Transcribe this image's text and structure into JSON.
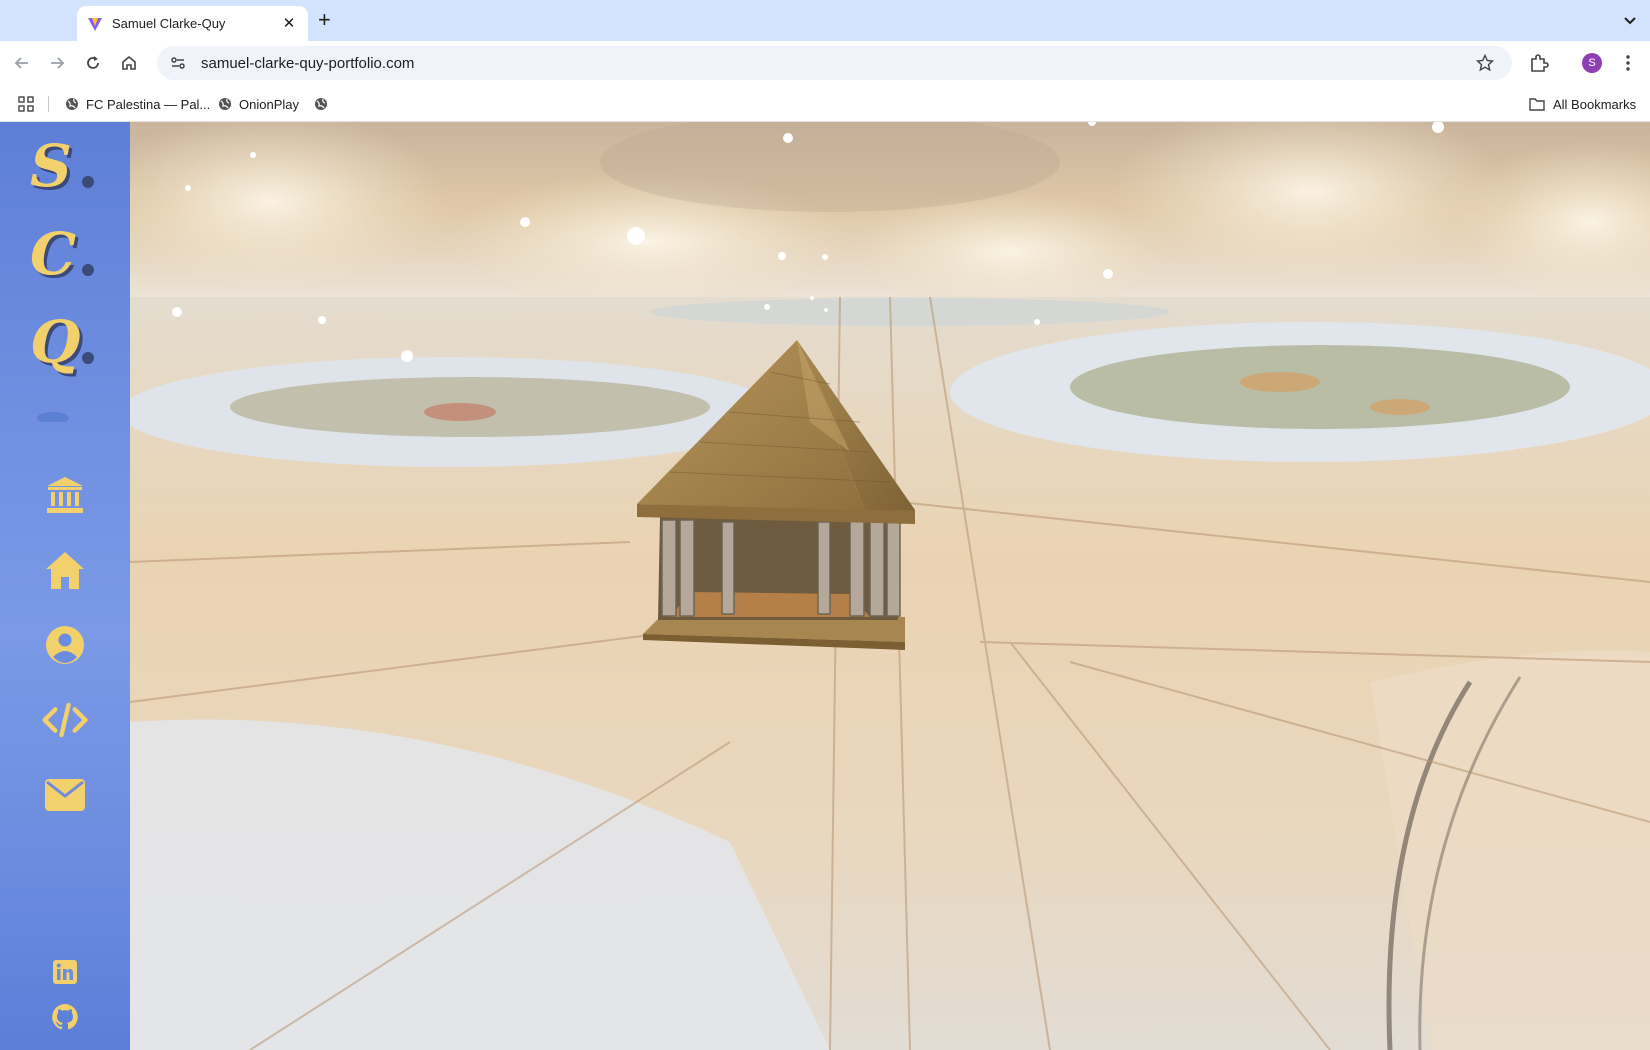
{
  "browser": {
    "tab_title": "Samuel Clarke-Quy",
    "tab_close": "✕",
    "new_tab": "+",
    "url": "samuel-clarke-quy-portfolio.com",
    "profile_initial": "S",
    "profile_color": "#8e3fb3"
  },
  "bookmarks": {
    "items": [
      {
        "label": "FC Palestina — Pal...",
        "icon": "globe-icon"
      },
      {
        "label": "OnionPlay",
        "icon": "globe-icon"
      },
      {
        "label": "",
        "icon": "globe-icon"
      }
    ],
    "all_label": "All Bookmarks"
  },
  "sidebar": {
    "logos": [
      {
        "letter": "S",
        "name": "logo-s"
      },
      {
        "letter": "C",
        "name": "logo-c"
      },
      {
        "letter": "Q",
        "name": "logo-q"
      }
    ],
    "nav": [
      {
        "name": "museum-icon"
      },
      {
        "name": "home-icon"
      },
      {
        "name": "profile-icon"
      },
      {
        "name": "code-icon"
      },
      {
        "name": "mail-icon"
      }
    ],
    "social": [
      {
        "name": "linkedin-icon"
      },
      {
        "name": "github-icon"
      }
    ],
    "colors": {
      "background": "#6b8cdf",
      "icon": "#f2d06b",
      "accent": "#3b4a78"
    }
  },
  "scene": {
    "subject": "temple-3d-model",
    "sky_color": "#d9c3a4",
    "floor_color": "#e8d4b8"
  }
}
